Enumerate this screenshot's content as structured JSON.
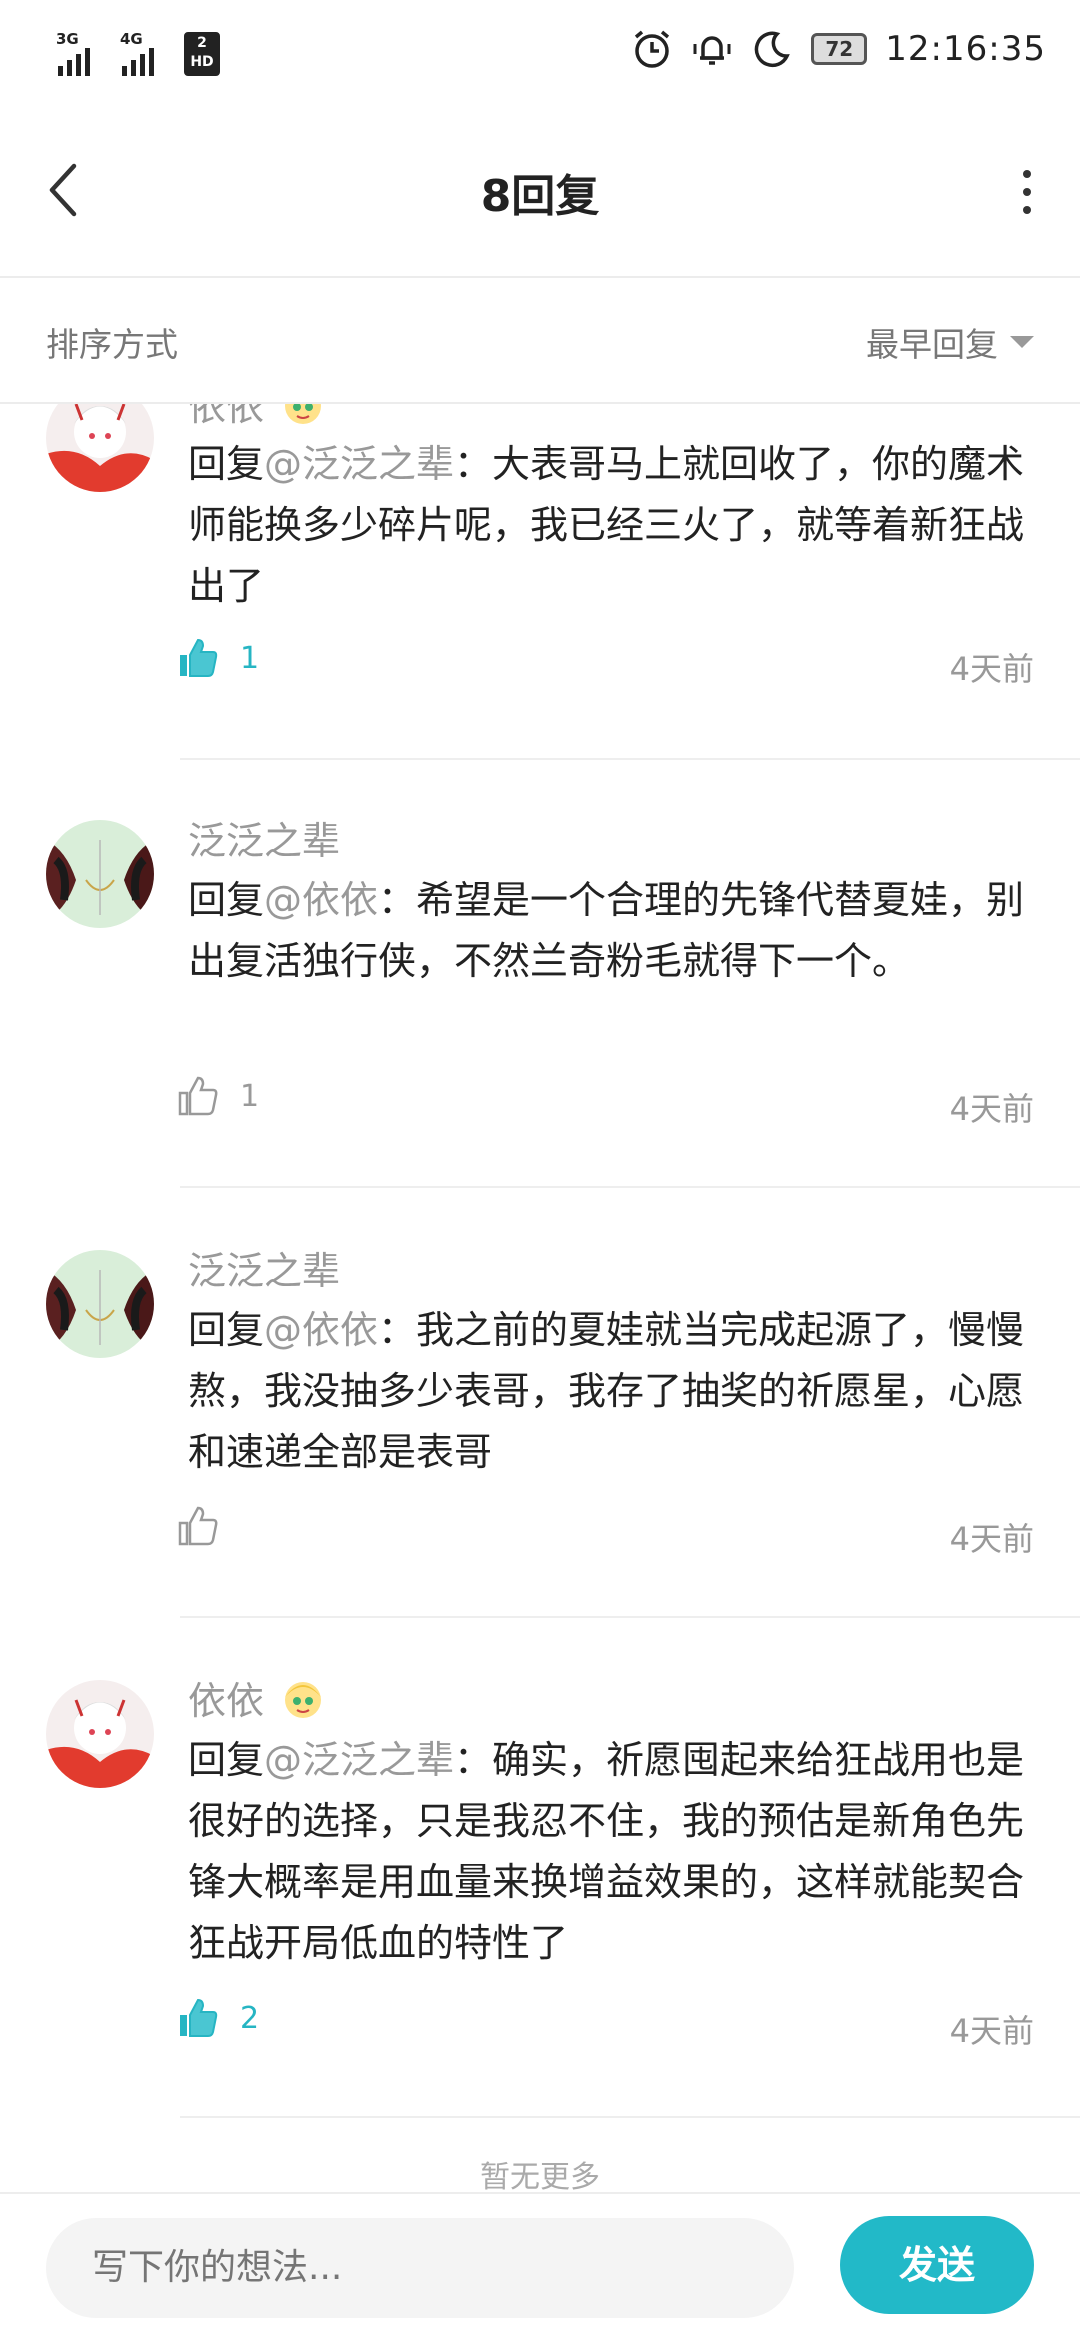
{
  "status_bar": {
    "sim1_gen": "3G",
    "sim2_gen": "4G",
    "hd_badge_num": "2",
    "hd_badge_text": "HD",
    "battery": "72",
    "time": "12:16:35"
  },
  "header": {
    "title": "8回复"
  },
  "sort_bar": {
    "label": "排序方式",
    "value": "最早回复"
  },
  "replies": [
    {
      "user": "依依",
      "prefix": "回复",
      "mention": "@泛泛之辈",
      "text": "：大表哥马上就回收了，你的魔术师能换多少碎片呢，我已经三火了，就等着新狂战出了",
      "likes": "1",
      "liked": true,
      "time": "4天前"
    },
    {
      "user": "泛泛之辈",
      "prefix": "回复",
      "mention": "@依依",
      "text": "：希望是一个合理的先锋代替夏娃，别出复活独行侠，不然兰奇粉毛就得下一个。",
      "likes": "1",
      "liked": false,
      "time": "4天前"
    },
    {
      "user": "泛泛之辈",
      "prefix": "回复",
      "mention": "@依依",
      "text": "：我之前的夏娃就当完成起源了，慢慢熬，我没抽多少表哥，我存了抽奖的祈愿星，心愿和速递全部是表哥",
      "likes": "",
      "liked": false,
      "time": "4天前"
    },
    {
      "user": "依依",
      "prefix": "回复",
      "mention": "@泛泛之辈",
      "text": "：确实，祈愿囤起来给狂战用也是很好的选择，只是我忍不住，我的预估是新角色先锋大概率是用血量来换增益效果的，这样就能契合狂战开局低血的特性了",
      "likes": "2",
      "liked": true,
      "time": "4天前"
    }
  ],
  "no_more": "暂无更多",
  "composer": {
    "placeholder": "写下你的想法...",
    "send_label": "发送"
  },
  "colors": {
    "accent": "#22b9c8",
    "mention": "#999999"
  }
}
